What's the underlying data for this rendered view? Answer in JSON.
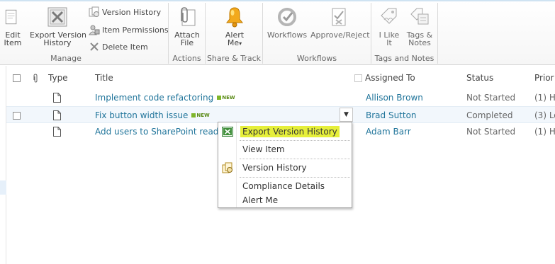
{
  "ribbon": {
    "manage": {
      "label": "Manage",
      "edit_item": [
        "Edit",
        "Item"
      ],
      "export_version_history": [
        "Export Version",
        "History"
      ],
      "version_history": "Version History",
      "item_permissions": "Item Permissions",
      "delete_item": "Delete Item"
    },
    "actions": {
      "label": "Actions",
      "attach_file": [
        "Attach",
        "File"
      ]
    },
    "share_track": {
      "label": "Share & Track",
      "alert_me": [
        "Alert",
        "Me"
      ]
    },
    "workflows": {
      "label": "Workflows",
      "workflows": "Workflows",
      "approve_reject": "Approve/Reject"
    },
    "tags_notes": {
      "label": "Tags and Notes",
      "i_like_it": [
        "I Like",
        "It"
      ],
      "tags_notes": [
        "Tags &",
        "Notes"
      ]
    }
  },
  "list": {
    "columns": {
      "type": "Type",
      "title": "Title",
      "assigned_to": "Assigned To",
      "status": "Status",
      "priority": "Prior"
    },
    "new_badge": "NEW",
    "rows": [
      {
        "title": "Implement code refactoring",
        "is_new": true,
        "assigned_to": "Allison Brown",
        "status": "Not Started",
        "priority": "(1) H"
      },
      {
        "title": "Fix button width issue",
        "is_new": true,
        "assigned_to": "Brad Sutton",
        "status": "Completed",
        "priority": "(3) Lo"
      },
      {
        "title": "Add users to SharePoint reade",
        "is_new": false,
        "assigned_to": "Adam Barr",
        "status": "Not Started",
        "priority": "(1) H"
      }
    ]
  },
  "context_menu": {
    "items": [
      {
        "label": "Export Version History",
        "icon": "excel-icon",
        "highlighted": true
      },
      {
        "label": "View Item",
        "icon": "",
        "highlighted": false
      },
      {
        "label": "Version History",
        "icon": "version-history-icon",
        "highlighted": false
      },
      {
        "label": "Compliance Details",
        "icon": "",
        "highlighted": false
      },
      {
        "label": "Alert Me",
        "icon": "",
        "highlighted": false
      }
    ]
  },
  "colors": {
    "link": "#21759b",
    "highlight": "#e6ef3a",
    "selected_row": "#f2f7fc",
    "new_badge": "#5a8a16"
  }
}
